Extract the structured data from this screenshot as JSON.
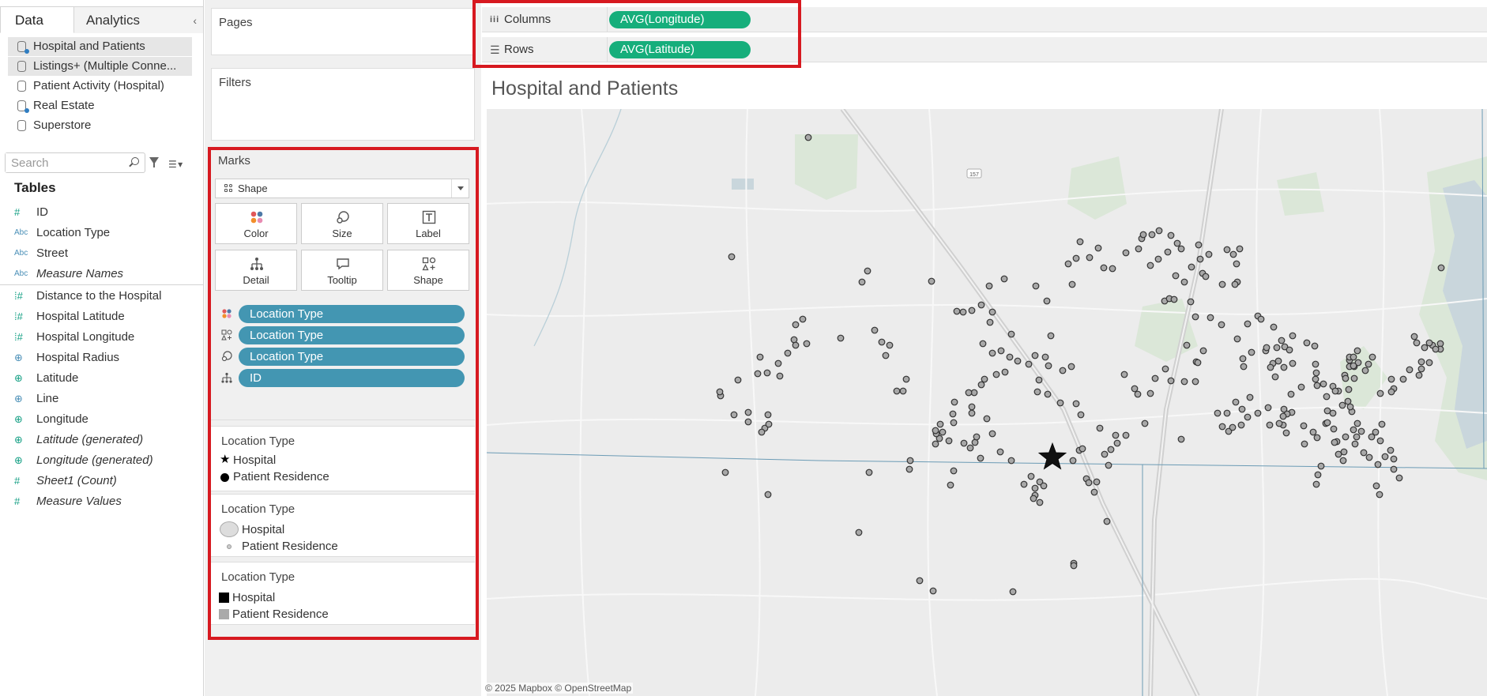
{
  "left_pane": {
    "tab_data": "Data",
    "tab_analytics": "Analytics",
    "collapse_glyph": "‹",
    "datasources": [
      {
        "label": "Hospital and Patients",
        "selected": true
      },
      {
        "label": "Listings+ (Multiple Conne...",
        "selected": false
      },
      {
        "label": "Patient Activity (Hospital)",
        "selected": false
      },
      {
        "label": "Real Estate",
        "selected": false
      },
      {
        "label": "Superstore",
        "selected": false
      }
    ],
    "search_placeholder": "Search",
    "tables_header": "Tables",
    "fields": [
      {
        "label": "ID",
        "type": "#"
      },
      {
        "label": "Location Type",
        "type": "Abc"
      },
      {
        "label": "Street",
        "type": "Abc"
      },
      {
        "label": "Measure Names",
        "type": "Abc"
      },
      {
        "label": "Distance to the Hospital",
        "type": "#"
      },
      {
        "label": "Hospital Latitude",
        "type": "#"
      },
      {
        "label": "Hospital Longitude",
        "type": "#"
      },
      {
        "label": "Hospital Radius",
        "type": "geo"
      },
      {
        "label": "Latitude",
        "type": "geo"
      },
      {
        "label": "Line",
        "type": "geo"
      },
      {
        "label": "Longitude",
        "type": "geo"
      },
      {
        "label": "Latitude (generated)",
        "type": "geo"
      },
      {
        "label": "Longitude (generated)",
        "type": "geo"
      },
      {
        "label": "Sheet1 (Count)",
        "type": "#"
      },
      {
        "label": "Measure Values",
        "type": "#"
      }
    ]
  },
  "pages_label": "Pages",
  "filters_label": "Filters",
  "marks": {
    "header": "Marks",
    "mark_type": "Shape",
    "buttons": [
      "Color",
      "Size",
      "Label",
      "Detail",
      "Tooltip",
      "Shape"
    ],
    "pills": [
      "Location Type",
      "Location Type",
      "Location Type",
      "ID"
    ]
  },
  "legends": [
    {
      "title": "Location Type",
      "items": [
        "Hospital",
        "Patient Residence"
      ]
    },
    {
      "title": "Location Type",
      "items": [
        "Hospital",
        "Patient Residence"
      ]
    },
    {
      "title": "Location Type",
      "items": [
        "Hospital",
        "Patient Residence"
      ]
    }
  ],
  "shelves": {
    "columns_label": "Columns",
    "columns_pill": "AVG(Longitude)",
    "rows_label": "Rows",
    "rows_pill": "AVG(Latitude)"
  },
  "view": {
    "title": "Hospital and Patients",
    "attribution": "© 2025 Mapbox © OpenStreetMap",
    "road_label": "157"
  },
  "colors": {
    "highlight": "#d71920",
    "dimension_pill": "#4396b2",
    "measure_pill": "#16ae7b"
  }
}
